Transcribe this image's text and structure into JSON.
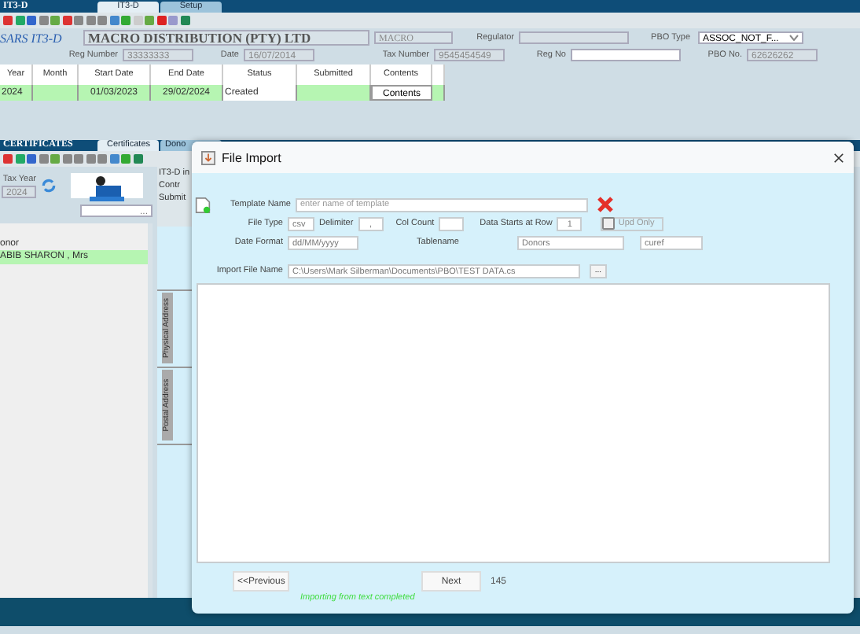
{
  "main_window": {
    "title": "IT3-D",
    "tabs": [
      {
        "label": "IT3-D",
        "selected": true
      },
      {
        "label": "Setup",
        "selected": false
      }
    ],
    "header": {
      "app_title": "SARS IT3-D",
      "company_name": "MACRO DISTRIBUTION (PTY) LTD",
      "short_name": "MACRO",
      "reg_number_label": "Reg Number",
      "reg_number": "33333333",
      "date_label": "Date",
      "date": "16/07/2014",
      "tax_number_label": "Tax Number",
      "tax_number": "9545454549",
      "regulator_label": "Regulator",
      "reg_no_label": "Reg No",
      "pbo_type_label": "PBO Type",
      "pbo_type": "ASSOC_NOT_F...",
      "pbo_no_label": "PBO No.",
      "pbo_no": "62626262"
    },
    "table": {
      "columns": [
        "Year",
        "Month",
        "Start Date",
        "End Date",
        "Status",
        "Submitted",
        "Contents"
      ],
      "rows": [
        {
          "year": "2024",
          "start_date": "01/03/2023",
          "end_date": "29/02/2024",
          "status": "Created",
          "contents_button": "Contents"
        }
      ]
    }
  },
  "certificates_window": {
    "title": "CERTIFICATES",
    "tabs": [
      {
        "label": "Certificates",
        "selected": true
      },
      {
        "label": "Dono",
        "selected": false
      }
    ],
    "tax_year_label": "Tax Year",
    "tax_year": "2024",
    "lookup_button": "...",
    "list_header": "onor",
    "donors": [
      {
        "name": "ABIB SHARON , Mrs",
        "selected": true
      }
    ],
    "side_labels": [
      "IT3-D in",
      "Contr",
      "Submit"
    ],
    "side_tabs": [
      "Physical Address",
      "Postal Address"
    ]
  },
  "dialog": {
    "title": "File Import",
    "template_name_label": "Template Name",
    "template_name_placeholder": "enter name of template",
    "file_type_label": "File Type",
    "file_type": "csv",
    "delimiter_label": "Delimiter",
    "delimiter": ",",
    "col_count_label": "Col Count",
    "data_starts_label": "Data Starts at Row",
    "data_starts": "1",
    "upd_only": {
      "label": "Upd Only",
      "checked": false
    },
    "date_format_label": "Date Format",
    "date_format": "dd/MM/yyyy",
    "tablename_label": "Tablename",
    "tablename": "Donors",
    "key_field": "curef",
    "import_file_label": "Import File Name",
    "import_file": "C:\\Users\\Mark Silberman\\Documents\\PBO\\TEST DATA.cs",
    "browse_button": "...",
    "previous_button": "<<Previous",
    "next_button": "Next",
    "record_count": "145",
    "status": "Importing from text completed"
  }
}
